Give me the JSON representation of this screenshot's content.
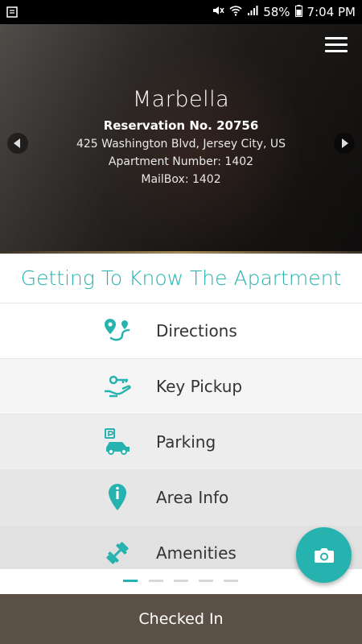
{
  "status_bar": {
    "battery": "58%",
    "time": "7:04 PM"
  },
  "hero": {
    "title": "Marbella",
    "reservation": "Reservation No. 20756",
    "address": "425 Washington Blvd, Jersey City, US",
    "apartment": "Apartment Number: 1402",
    "mailbox": "MailBox: 1402"
  },
  "section": {
    "title": "Getting To Know The Apartment"
  },
  "menu": [
    {
      "label": "Directions",
      "icon": "directions-icon"
    },
    {
      "label": "Key Pickup",
      "icon": "key-pickup-icon"
    },
    {
      "label": "Parking",
      "icon": "parking-icon"
    },
    {
      "label": "Area Info",
      "icon": "area-info-icon"
    },
    {
      "label": "Amenities",
      "icon": "amenities-icon"
    }
  ],
  "pager": {
    "count": 5,
    "active": 1
  },
  "footer": {
    "status": "Checked In"
  },
  "colors": {
    "accent": "#26b3b0",
    "footer_bg": "#5a5046"
  }
}
